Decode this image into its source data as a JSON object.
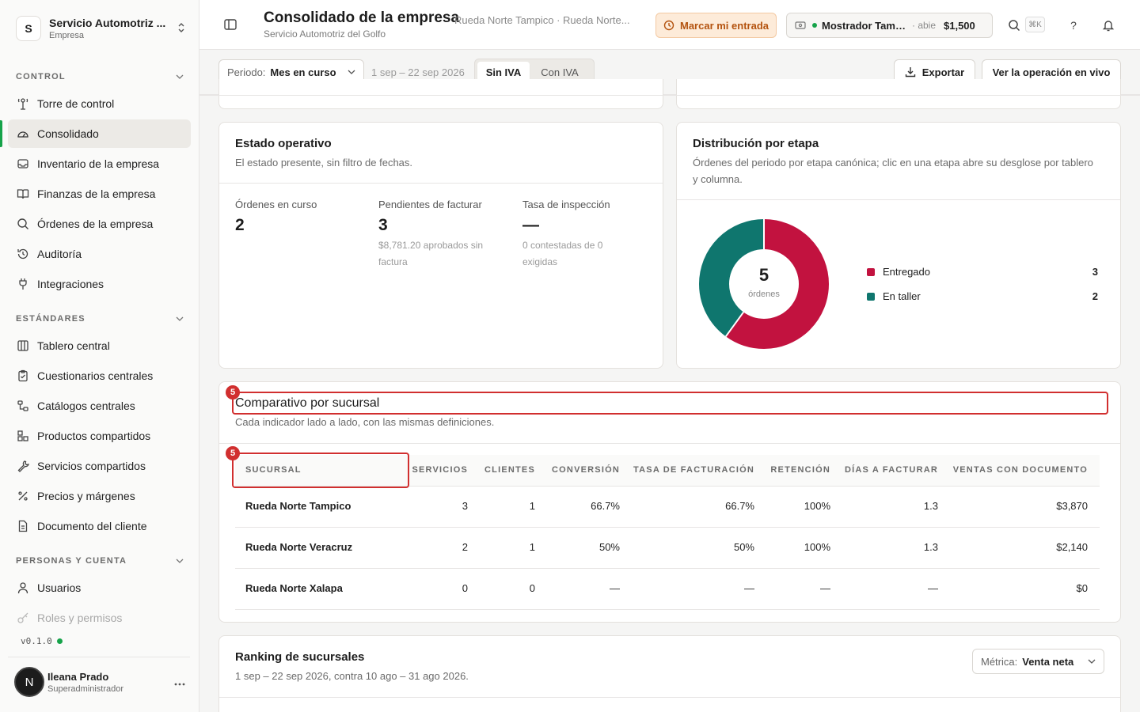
{
  "org": {
    "name": "Servicio Automotriz ...",
    "type": "Empresa",
    "initial": "S"
  },
  "sidebar": {
    "sections": [
      {
        "title": "CONTROL",
        "items": [
          {
            "label": "Torre de control",
            "icon": "tower-icon"
          },
          {
            "label": "Consolidado",
            "icon": "gauge-icon",
            "active": true
          },
          {
            "label": "Inventario de la empresa",
            "icon": "inbox-icon"
          },
          {
            "label": "Finanzas de la empresa",
            "icon": "book-icon"
          },
          {
            "label": "Órdenes de la empresa",
            "icon": "search-icon"
          },
          {
            "label": "Auditoría",
            "icon": "history-icon"
          },
          {
            "label": "Integraciones",
            "icon": "plug-icon"
          }
        ]
      },
      {
        "title": "ESTÁNDARES",
        "items": [
          {
            "label": "Tablero central",
            "icon": "columns-icon"
          },
          {
            "label": "Cuestionarios centrales",
            "icon": "clipboard-icon"
          },
          {
            "label": "Catálogos centrales",
            "icon": "network-icon"
          },
          {
            "label": "Productos compartidos",
            "icon": "boxes-icon"
          },
          {
            "label": "Servicios compartidos",
            "icon": "wrench-icon"
          },
          {
            "label": "Precios y márgenes",
            "icon": "percent-icon"
          },
          {
            "label": "Documento del cliente",
            "icon": "document-icon"
          }
        ]
      },
      {
        "title": "PERSONAS Y CUENTA",
        "items": [
          {
            "label": "Usuarios",
            "icon": "user-icon"
          },
          {
            "label": "Roles y permisos",
            "icon": "key-icon"
          }
        ]
      }
    ],
    "version": "v0.1.0"
  },
  "user": {
    "name": "Ileana Prado",
    "role": "Superadministrador",
    "initial": "N"
  },
  "header": {
    "title": "Consolidado de la empresa",
    "subtitle": "Servicio Automotriz del Golfo",
    "breadcrumb": "Rueda Norte Tampico · Rueda Norte...",
    "entry_button": "Marcar mi entrada",
    "register": {
      "name": "Mostrador Tampi...",
      "status": "· abie",
      "amount": "$1,500"
    },
    "shortcut": "⌘K",
    "help": "?"
  },
  "toolbar": {
    "period_label": "Periodo:",
    "period_value": "Mes en curso",
    "range": "1 sep – 22 sep 2026",
    "tax_toggle": {
      "on": "Sin IVA",
      "off": "Con IVA"
    },
    "export_label": "Exportar",
    "live_label": "Ver la operación en vivo"
  },
  "estado": {
    "title": "Estado operativo",
    "desc": "El estado presente, sin filtro de fechas.",
    "kpis": [
      {
        "label": "Órdenes en curso",
        "value": "2",
        "note": ""
      },
      {
        "label": "Pendientes de facturar",
        "value": "3",
        "note": "$8,781.20 aprobados sin factura"
      },
      {
        "label": "Tasa de inspección",
        "value": "—",
        "note": "0 contestadas de 0 exigidas"
      }
    ]
  },
  "distribucion": {
    "title": "Distribución por etapa",
    "desc": "Órdenes del periodo por etapa canónica; clic en una etapa abre su desglose por tablero y columna.",
    "total": "5",
    "total_label": "órdenes"
  },
  "chart_data": {
    "type": "pie",
    "categories": [
      "Entregado",
      "En taller"
    ],
    "values": [
      3,
      2
    ],
    "colors": [
      "#c2123f",
      "#0f766e"
    ]
  },
  "comparativo": {
    "title": "Comparativo por sucursal",
    "desc": "Cada indicador lado a lado, con las mismas definiciones.",
    "badge": "5",
    "columns": [
      "SUCURSAL",
      "SERVICIOS",
      "CLIENTES",
      "CONVERSIÓN",
      "TASA DE FACTURACIÓN",
      "RETENCIÓN",
      "DÍAS A FACTURAR",
      "VENTAS CON DOCUMENTO"
    ],
    "rows": [
      [
        "Rueda Norte Tampico",
        "3",
        "1",
        "66.7%",
        "66.7%",
        "100%",
        "1.3",
        "$3,870"
      ],
      [
        "Rueda Norte Veracruz",
        "2",
        "1",
        "50%",
        "50%",
        "100%",
        "1.3",
        "$2,140"
      ],
      [
        "Rueda Norte Xalapa",
        "0",
        "0",
        "—",
        "—",
        "—",
        "—",
        "$0"
      ]
    ]
  },
  "ranking": {
    "title": "Ranking de sucursales",
    "desc": "1 sep – 22 sep 2026, contra 10 ago – 31 ago 2026.",
    "metric_label": "Métrica:",
    "metric_value": "Venta neta"
  }
}
